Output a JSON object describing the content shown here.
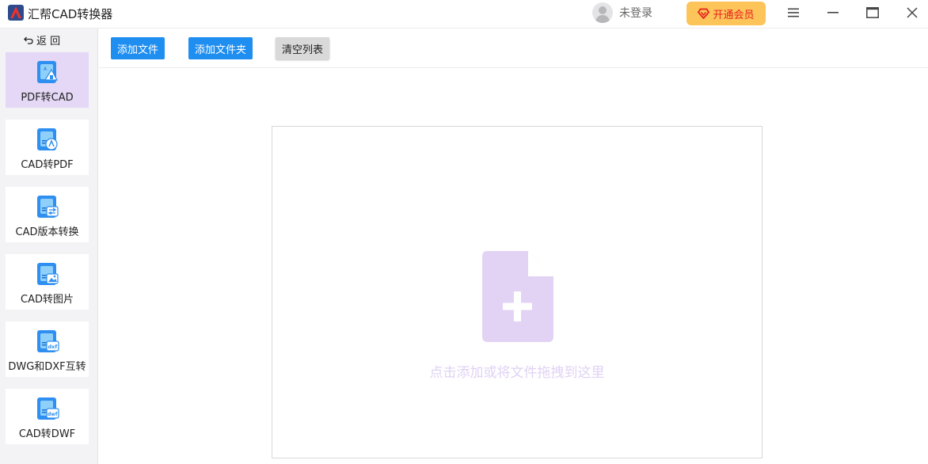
{
  "app": {
    "title": "汇帮CAD转换器"
  },
  "titlebar": {
    "login_text": "未登录",
    "vip_label": "开通会员"
  },
  "sidebar": {
    "back_label": "返 回",
    "items": [
      {
        "label": "PDF转CAD",
        "icon": "pdf-to-cad-icon",
        "active": true
      },
      {
        "label": "CAD转PDF",
        "icon": "cad-to-pdf-icon",
        "active": false
      },
      {
        "label": "CAD版本转换",
        "icon": "cad-version-convert-icon",
        "active": false
      },
      {
        "label": "CAD转图片",
        "icon": "cad-to-image-icon",
        "active": false
      },
      {
        "label": "DWG和DXF互转",
        "icon": "dwg-dxf-convert-icon",
        "active": false
      },
      {
        "label": "CAD转DWF",
        "icon": "cad-to-dwf-icon",
        "active": false
      }
    ]
  },
  "toolbar": {
    "add_file_label": "添加文件",
    "add_folder_label": "添加文件夹",
    "clear_list_label": "清空列表"
  },
  "dropzone": {
    "hint": "点击添加或将文件拖拽到这里"
  },
  "colors": {
    "accent_blue": "#1f8ef1",
    "active_bg": "#e4d8f6",
    "vip_bg": "#fdc45a",
    "vip_text": "#e6211c",
    "drop_icon": "#e2d3f5"
  }
}
